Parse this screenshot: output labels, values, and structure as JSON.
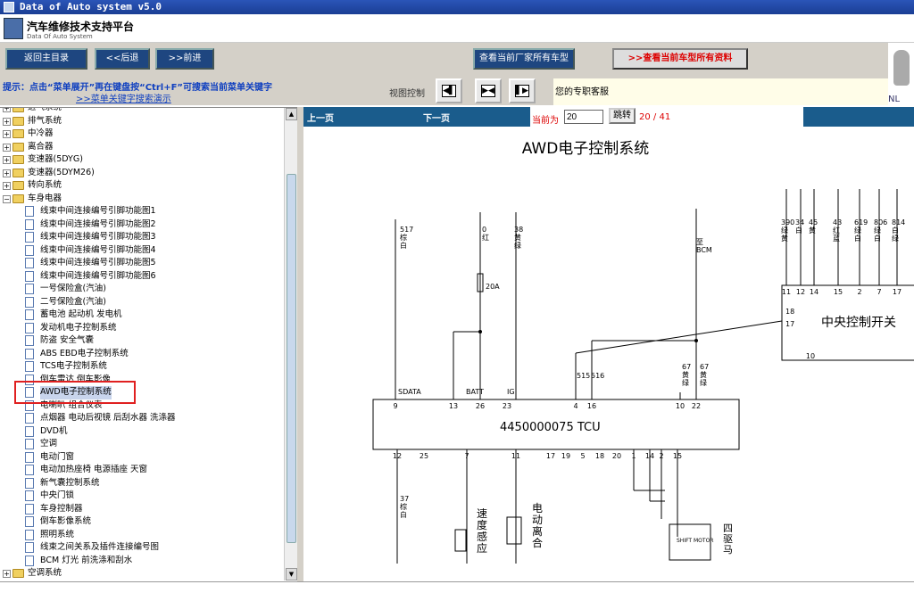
{
  "window": {
    "title": "Data of Auto system v5.0"
  },
  "header": {
    "title": "汽车维修技术支持平台",
    "subtitle": "Data Of Auto System"
  },
  "toolbar": {
    "back_main": "返回主目录",
    "back": "<<后退",
    "forward": ">>前进",
    "all_models": "查看当前厂家所有车型",
    "all_data": "查看当前车型所有资料"
  },
  "hint": {
    "line1": "提示：点击“菜单展开”再在键盘按“Ctrl+F”可搜索当前菜单关键字",
    "line2": ">>菜单关键字搜索演示",
    "view_control": "视图控制",
    "agent": "您的专职客服"
  },
  "avatar": {
    "label": "NL"
  },
  "tree": [
    {
      "level": 0,
      "type": "folder",
      "label": "进气系统"
    },
    {
      "level": 0,
      "type": "folder",
      "label": "排气系统"
    },
    {
      "level": 0,
      "type": "folder",
      "label": "中冷器"
    },
    {
      "level": 0,
      "type": "folder",
      "label": "离合器"
    },
    {
      "level": 0,
      "type": "folder",
      "label": "变速器(5DYG)"
    },
    {
      "level": 0,
      "type": "folder",
      "label": "变速器(5DYM26)"
    },
    {
      "level": 0,
      "type": "folder",
      "label": "转向系统"
    },
    {
      "level": 0,
      "type": "folder-open",
      "label": "车身电器"
    },
    {
      "level": 1,
      "type": "doc",
      "label": "线束中间连接编号引脚功能图1"
    },
    {
      "level": 1,
      "type": "doc",
      "label": "线束中间连接编号引脚功能图2"
    },
    {
      "level": 1,
      "type": "doc",
      "label": "线束中间连接编号引脚功能图3"
    },
    {
      "level": 1,
      "type": "doc",
      "label": "线束中间连接编号引脚功能图4"
    },
    {
      "level": 1,
      "type": "doc",
      "label": "线束中间连接编号引脚功能图5"
    },
    {
      "level": 1,
      "type": "doc",
      "label": "线束中间连接编号引脚功能图6"
    },
    {
      "level": 1,
      "type": "doc",
      "label": "一号保险盒(汽油)"
    },
    {
      "level": 1,
      "type": "doc",
      "label": "二号保险盒(汽油)"
    },
    {
      "level": 1,
      "type": "doc",
      "label": "蓄电池 起动机 发电机"
    },
    {
      "level": 1,
      "type": "doc",
      "label": "发动机电子控制系统"
    },
    {
      "level": 1,
      "type": "doc",
      "label": "防盗 安全气囊"
    },
    {
      "level": 1,
      "type": "doc",
      "label": "ABS EBD电子控制系统"
    },
    {
      "level": 1,
      "type": "doc",
      "label": "TCS电子控制系统"
    },
    {
      "level": 1,
      "type": "doc",
      "label": "倒车雷达 倒车影像"
    },
    {
      "level": 1,
      "type": "doc",
      "label": "AWD电子控制系统",
      "selected": true
    },
    {
      "level": 1,
      "type": "doc",
      "label": "电喇叭 组合仪表"
    },
    {
      "level": 1,
      "type": "doc",
      "label": "点烟器 电动后视镜 后刮水器 洗涤器"
    },
    {
      "level": 1,
      "type": "doc",
      "label": "DVD机"
    },
    {
      "level": 1,
      "type": "doc",
      "label": "空调"
    },
    {
      "level": 1,
      "type": "doc",
      "label": "电动门窗"
    },
    {
      "level": 1,
      "type": "doc",
      "label": "电动加热座椅 电源插座 天窗"
    },
    {
      "level": 1,
      "type": "doc",
      "label": "新气囊控制系统"
    },
    {
      "level": 1,
      "type": "doc",
      "label": "中央门锁"
    },
    {
      "level": 1,
      "type": "doc",
      "label": "车身控制器"
    },
    {
      "level": 1,
      "type": "doc",
      "label": "倒车影像系统"
    },
    {
      "level": 1,
      "type": "doc",
      "label": "照明系统"
    },
    {
      "level": 1,
      "type": "doc",
      "label": "线束之间关系及插件连接编号图"
    },
    {
      "level": 1,
      "type": "doc",
      "label": "BCM 灯光 前洗涤和刮水"
    },
    {
      "level": 0,
      "type": "folder",
      "label": "空调系统"
    }
  ],
  "pager": {
    "prev": "上一页",
    "next": "下一页",
    "current_label": "当前为",
    "current": "20",
    "go": "跳转",
    "total": "20 / 41"
  },
  "diagram": {
    "title": "AWD电子控制系统",
    "tcu": "4450000075  TCU",
    "central_switch": "中央控制开关",
    "bcm": "至\nBCM",
    "fuse": "20A",
    "pins_top": [
      "9",
      "13",
      "26",
      "23",
      "4",
      "16",
      "10",
      "22"
    ],
    "pins_bottom": [
      "12",
      "25",
      "7",
      "11",
      "17",
      "19",
      "5",
      "18",
      "20",
      "1",
      "14",
      "2",
      "15"
    ],
    "sig_top": [
      "SDATA",
      "BATT",
      "IG"
    ],
    "wire_top": [
      "517\n棕\n白",
      "0\n红",
      "38\n黄\n绿",
      "515",
      "516",
      "67\n黄\n绿",
      "67\n黄\n绿"
    ],
    "cs_pins_top": [
      "11",
      "12",
      "14",
      "15",
      "2",
      "7",
      "17"
    ],
    "cs_pins_left": [
      "18",
      "17"
    ],
    "cs_pin_bottom": "10",
    "cs_wires": [
      "390\n绿\n黄",
      "34\n白",
      "45\n黄",
      "43\n红\n蓝",
      "619\n绿\n白",
      "806\n绿\n白",
      "814\n白\n绿"
    ],
    "bottom_wire": "37\n棕\n白",
    "speed_sensor": "速度感应",
    "motor": "电动离合",
    "shift_motor": "SHIFT MOTOR",
    "four_wheel": "四驱马"
  }
}
